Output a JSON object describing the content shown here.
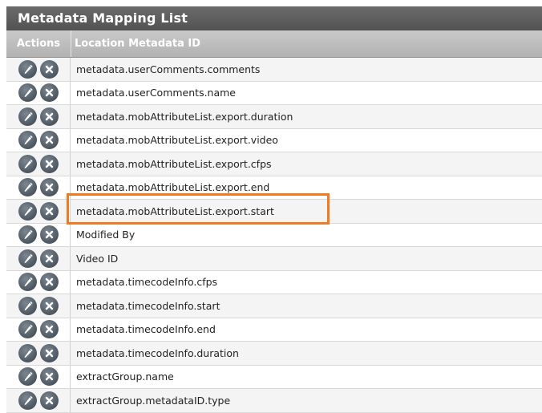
{
  "panel": {
    "title": "Metadata Mapping List"
  },
  "table": {
    "columns": [
      "Actions",
      "Location Metadata ID"
    ],
    "rows": [
      "metadata.userComments.comments",
      "metadata.userComments.name",
      "metadata.mobAttributeList.export.duration",
      "metadata.mobAttributeList.export.video",
      "metadata.mobAttributeList.export.cfps",
      "metadata.mobAttributeList.export.end",
      "metadata.mobAttributeList.export.start",
      "Modified By",
      "Video ID",
      "metadata.timecodeInfo.cfps",
      "metadata.timecodeInfo.start",
      "metadata.timecodeInfo.end",
      "metadata.timecodeInfo.duration",
      "extractGroup.name",
      "extractGroup.metadataID.type"
    ],
    "row_actions": [
      "edit-pencil-icon",
      "delete-x-icon"
    ],
    "highlighted_row_index": 6
  },
  "colors": {
    "title_bar": "#5e5e5e",
    "header": "#bdbdbd",
    "action_button": "#4c5660",
    "highlight": "#f07a1e"
  }
}
